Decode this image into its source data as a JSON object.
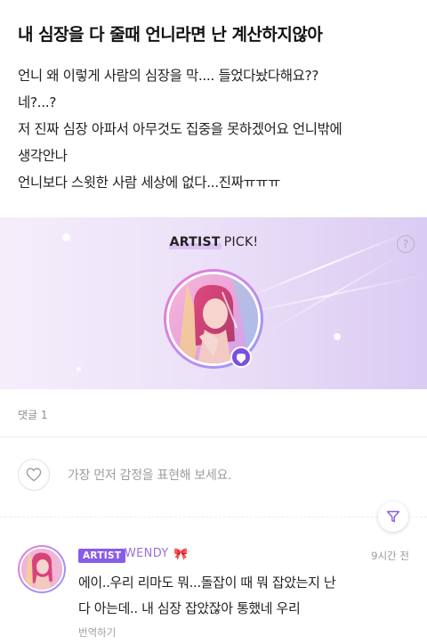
{
  "post": {
    "title": "내 심장을 다 줄때 언니라면 난 계산하지않아",
    "lines": [
      "언니 왜 이렇게 사람의 심장을 막.... 들었다놨다해요??",
      "네?...?",
      "저 진짜 심장 아파서 아무것도 집중을 못하겠어요 언니밖에",
      "생각안나",
      "언니보다 스윗한 사람 세상에 없다...진짜ㅠㅠㅠ"
    ]
  },
  "artist_pick": {
    "title_highlight": "ARTIST",
    "title_rest": "PICK!",
    "help_label": "?",
    "accent": "#8a5ce6"
  },
  "comments": {
    "count_label": "댓글 1",
    "react_placeholder": "가장 먼저 감정을 표현해 보세요.",
    "items": [
      {
        "tag": "ARTIST",
        "author": "WENDY",
        "author_emoji": "🎀",
        "time": "9시간 전",
        "lines": [
          "에이..우리 리마도 뭐...돌잡이 때 뭐 잡았는지 난",
          "다 아는데.. 내 심장 잡았잖아 통했네 우리"
        ],
        "translate_label": "번역하기"
      }
    ]
  },
  "icons": {
    "help": "question-icon",
    "chat": "chat-bubble-icon",
    "heart": "heart-outline-icon",
    "filter": "filter-icon"
  }
}
